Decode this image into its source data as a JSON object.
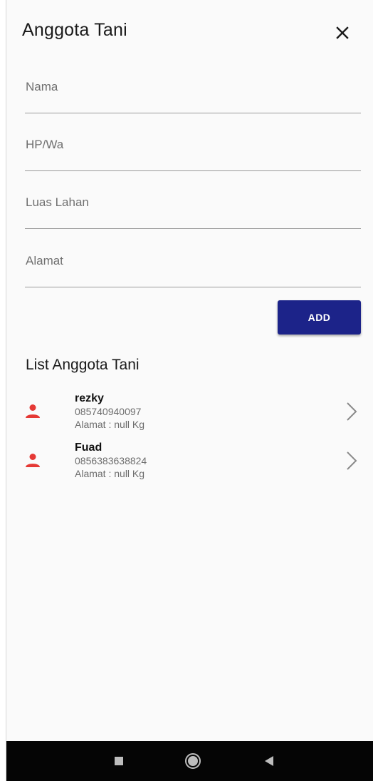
{
  "app_bar": {
    "title": "Anggota Tani",
    "close_icon": "close-icon"
  },
  "form": {
    "fields": [
      {
        "name": "nama",
        "placeholder": "Nama",
        "value": ""
      },
      {
        "name": "hp",
        "placeholder": "HP/Wa",
        "value": ""
      },
      {
        "name": "luas",
        "placeholder": "Luas Lahan",
        "value": ""
      },
      {
        "name": "alamat",
        "placeholder": "Alamat",
        "value": ""
      }
    ],
    "add_label": "ADD",
    "add_color": "#1c2389"
  },
  "list": {
    "title": "List Anggota Tani",
    "icon_color": "#e53935",
    "items": [
      {
        "name": "rezky",
        "phone": "085740940097",
        "address": "Alamat : null Kg",
        "icon": "person-icon"
      },
      {
        "name": "Fuad",
        "phone": "0856383638824",
        "address": "Alamat : null Kg",
        "icon": "person-icon"
      }
    ]
  },
  "nav_bar": {
    "buttons": [
      "recents-icon",
      "home-icon",
      "back-icon"
    ]
  }
}
